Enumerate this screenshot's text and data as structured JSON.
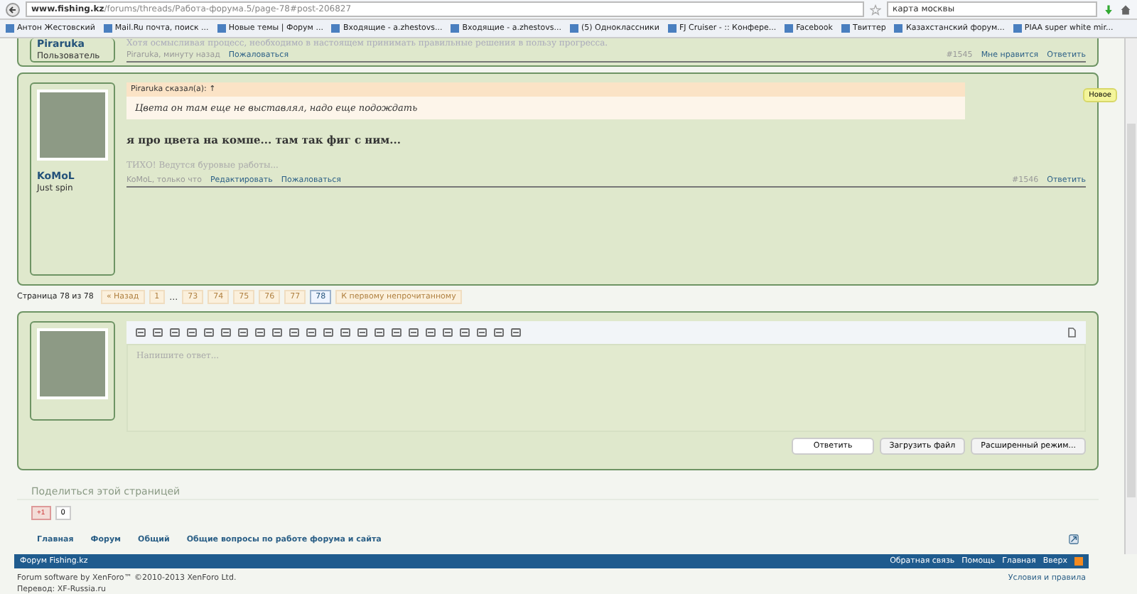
{
  "browser": {
    "url_host": "www.fishing.kz",
    "url_path": "/forums/threads/Работа-форума.5/page-78#post-206827",
    "search": "карта москвы"
  },
  "bookmarks": [
    {
      "label": "Антон Жестовский"
    },
    {
      "label": "Mail.Ru почта, поиск ..."
    },
    {
      "label": "Новые темы | Форум ..."
    },
    {
      "label": "Входящие - a.zhestovs..."
    },
    {
      "label": "Входящие - a.zhestovs..."
    },
    {
      "label": "(5) Одноклассники"
    },
    {
      "label": "FJ Cruiser - :: Конфере..."
    },
    {
      "label": "Facebook"
    },
    {
      "label": "Твиттер"
    },
    {
      "label": "Казахстанский форум..."
    },
    {
      "label": "PIAA super white mir..."
    }
  ],
  "previous_post": {
    "username": "Piraruka",
    "user_title": "Пользователь",
    "text_fragment": "Хотя осмысливая процесс, необходимо в настоящем принимать правильные решения в пользу прогресса.",
    "meta": "Piraruka, минуту назад",
    "report": "Пожаловаться",
    "number": "#1545",
    "like": "Мне нравится",
    "reply": "Ответить"
  },
  "post": {
    "username": "KoMoL",
    "user_title": "Just spin",
    "badge": "Новое",
    "quote_author": "Piraruka сказал(а): ↑",
    "quote_text": "Цвета он там еще не выставлял, надо еще подождать",
    "message": "я про цвета на компе... там так фиг с ним...",
    "signature": "ТИХО! Ведутся буровые работы...",
    "meta": "KoMoL, только что",
    "edit": "Редактировать",
    "report": "Пожаловаться",
    "number": "#1546",
    "reply": "Ответить"
  },
  "pagination": {
    "label": "Страница 78 из 78",
    "prev": "« Назад",
    "pages": [
      {
        "label": "1",
        "selected": false
      },
      {
        "label": "…",
        "kind": "gap"
      },
      {
        "label": "73",
        "selected": false
      },
      {
        "label": "74",
        "selected": false
      },
      {
        "label": "75",
        "selected": false
      },
      {
        "label": "76",
        "selected": false
      },
      {
        "label": "77",
        "selected": false
      },
      {
        "label": "78",
        "selected": true
      }
    ],
    "unread": "К первому непрочитанному"
  },
  "editor": {
    "placeholder": "Напишите ответ...",
    "buttons": [
      "Ответить",
      "Загрузить файл",
      "Расширенный режим..."
    ]
  },
  "share": {
    "title": "Поделиться этой страницей",
    "gplus": "+1",
    "count": "0"
  },
  "breadcrumbs": [
    "Главная",
    "Форум",
    "Общий",
    "Общие вопросы по работе форума и сайта"
  ],
  "footer": {
    "title": "Форум Fishing.kz",
    "links": [
      "Обратная связь",
      "Помощь",
      "Главная",
      "Вверх"
    ],
    "copyright": "Forum software by XenForo™ ©2010-2013 XenForo Ltd.",
    "translation": "Перевод: XF-Russia.ru",
    "terms": "Условия и правила"
  }
}
